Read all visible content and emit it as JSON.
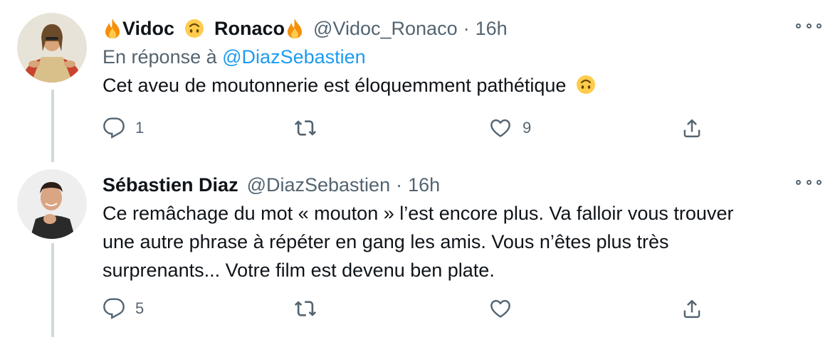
{
  "tweets": [
    {
      "display_name_first": "Vidoc",
      "display_name_second": "Ronaco",
      "handle": "@Vidoc_Ronaco",
      "separator": "·",
      "time": "16h",
      "reply_prefix": "En réponse à",
      "reply_mention": "@DiazSebastien",
      "text": "Cet aveu de moutonnerie est éloquemment pathétique",
      "replies": "1",
      "retweets": "",
      "likes": "9"
    },
    {
      "display_name": "Sébastien Diaz",
      "handle": "@DiazSebastien",
      "separator": "·",
      "time": "16h",
      "text_lines": [
        "Ce remâchage du mot « mouton » l’est encore plus. Va falloir vous trouver",
        "une autre phrase à répéter en gang les amis. Vous n’êtes plus très",
        "surprenants... Votre film est devenu ben plate."
      ],
      "replies": "5",
      "retweets": "",
      "likes": ""
    }
  ],
  "colors": {
    "text": "#0f1419",
    "secondary": "#536471",
    "link": "#1d9bf0",
    "thread_line": "#cfd9de"
  },
  "icons": [
    "fire-icon",
    "upside-down-face-icon",
    "reply-icon",
    "retweet-icon",
    "like-icon",
    "share-icon",
    "more-icon"
  ]
}
